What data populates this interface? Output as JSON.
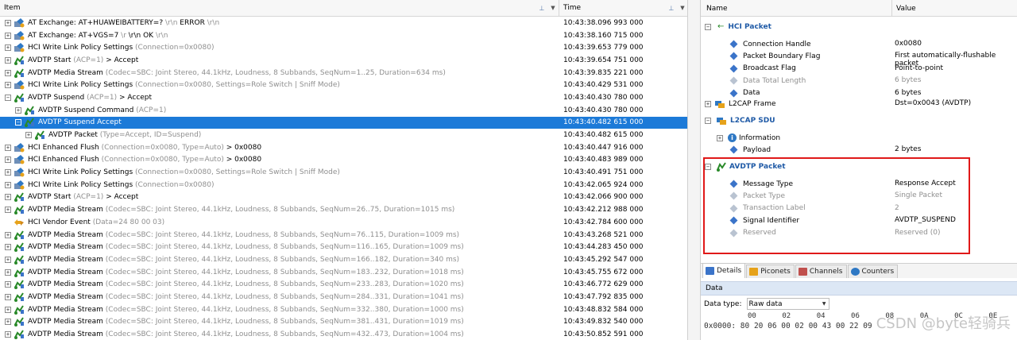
{
  "list": {
    "col_item": "Item",
    "col_time": "Time",
    "rows": [
      {
        "expander": "+",
        "icon": "hci-icon",
        "indent": 0,
        "name": "AT Exchange: AT+HUAWEIBATTERY=?",
        "params": " \\r\\n ",
        "suffix": "ERROR",
        "params2": " \\r\\n",
        "time": "10:43:38.096 993 000"
      },
      {
        "expander": "+",
        "icon": "hci-icon",
        "indent": 0,
        "name": "AT Exchange: AT+VGS=7",
        "params": " \\r ",
        "suffix": "\\r\\n OK",
        "params2": " \\r\\n",
        "time": "10:43:38.160 715 000"
      },
      {
        "expander": "+",
        "icon": "hci-icon",
        "indent": 0,
        "name": "HCI Write Link Policy Settings",
        "params": " (Connection=0x0080)",
        "suffix": "",
        "params2": "",
        "time": "10:43:39.653 779 000"
      },
      {
        "expander": "+",
        "icon": "avdtp-icon",
        "indent": 0,
        "name": "AVDTP Start",
        "params": " (ACP=1)",
        "suffix": " > Accept",
        "params2": "",
        "time": "10:43:39.654 751 000"
      },
      {
        "expander": "+",
        "icon": "avdtp-icon",
        "indent": 0,
        "name": "AVDTP Media Stream",
        "params": " (Codec=SBC: Joint Stereo, 44.1kHz, Loudness, 8 Subbands, SeqNum=1..25, Duration=634 ms)",
        "suffix": "",
        "params2": "",
        "time": "10:43:39.835 221 000"
      },
      {
        "expander": "+",
        "icon": "hci-icon",
        "indent": 0,
        "name": "HCI Write Link Policy Settings",
        "params": " (Connection=0x0080, Settings=Role Switch | Sniff Mode)",
        "suffix": "",
        "params2": "",
        "time": "10:43:40.429 531 000"
      },
      {
        "expander": "−",
        "icon": "avdtp-icon",
        "indent": 0,
        "name": "AVDTP Suspend",
        "params": " (ACP=1)",
        "suffix": " > Accept",
        "params2": "",
        "time": "10:43:40.430 780 000"
      },
      {
        "expander": "+",
        "icon": "avdtp-icon",
        "indent": 1,
        "name": "AVDTP Suspend Command",
        "params": " (ACP=1)",
        "suffix": "",
        "params2": "",
        "time": "10:43:40.430 780 000"
      },
      {
        "expander": "−",
        "icon": "avdtp-icon",
        "indent": 1,
        "name": "AVDTP Suspend Accept",
        "params": "",
        "suffix": "",
        "params2": "",
        "time": "10:43:40.482 615 000",
        "selected": true
      },
      {
        "expander": "+",
        "icon": "avdtp-icon",
        "indent": 2,
        "name": "AVDTP Packet",
        "params": " (Type=Accept, ID=Suspend)",
        "suffix": "",
        "params2": "",
        "time": "10:43:40.482 615 000"
      },
      {
        "expander": "+",
        "icon": "hci-icon",
        "indent": 0,
        "name": "HCI Enhanced Flush",
        "params": " (Connection=0x0080, Type=Auto)",
        "suffix": " > 0x0080",
        "params2": "",
        "time": "10:43:40.447 916 000"
      },
      {
        "expander": "+",
        "icon": "hci-icon",
        "indent": 0,
        "name": "HCI Enhanced Flush",
        "params": " (Connection=0x0080, Type=Auto)",
        "suffix": " > 0x0080",
        "params2": "",
        "time": "10:43:40.483 989 000"
      },
      {
        "expander": "+",
        "icon": "hci-icon",
        "indent": 0,
        "name": "HCI Write Link Policy Settings",
        "params": " (Connection=0x0080, Settings=Role Switch | Sniff Mode)",
        "suffix": "",
        "params2": "",
        "time": "10:43:40.491 751 000"
      },
      {
        "expander": "+",
        "icon": "hci-icon",
        "indent": 0,
        "name": "HCI Write Link Policy Settings",
        "params": " (Connection=0x0080)",
        "suffix": "",
        "params2": "",
        "time": "10:43:42.065 924 000"
      },
      {
        "expander": "+",
        "icon": "avdtp-icon",
        "indent": 0,
        "name": "AVDTP Start",
        "params": " (ACP=1)",
        "suffix": " > Accept",
        "params2": "",
        "time": "10:43:42.066 900 000"
      },
      {
        "expander": "+",
        "icon": "avdtp-icon",
        "indent": 0,
        "name": "AVDTP Media Stream",
        "params": " (Codec=SBC: Joint Stereo, 44.1kHz, Loudness, 8 Subbands, SeqNum=26..75, Duration=1015 ms)",
        "suffix": "",
        "params2": "",
        "time": "10:43:42.212 988 000"
      },
      {
        "expander": "",
        "icon": "vendor-icon",
        "indent": 0,
        "name": "HCI Vendor Event",
        "params": " (Data=24 80 00 03)",
        "suffix": "",
        "params2": "",
        "time": "10:43:42.784 600 000"
      },
      {
        "expander": "+",
        "icon": "avdtp-icon",
        "indent": 0,
        "name": "AVDTP Media Stream",
        "params": " (Codec=SBC: Joint Stereo, 44.1kHz, Loudness, 8 Subbands, SeqNum=76..115, Duration=1009 ms)",
        "suffix": "",
        "params2": "",
        "time": "10:43:43.268 521 000"
      },
      {
        "expander": "+",
        "icon": "avdtp-icon",
        "indent": 0,
        "name": "AVDTP Media Stream",
        "params": " (Codec=SBC: Joint Stereo, 44.1kHz, Loudness, 8 Subbands, SeqNum=116..165, Duration=1009 ms)",
        "suffix": "",
        "params2": "",
        "time": "10:43:44.283 450 000"
      },
      {
        "expander": "+",
        "icon": "avdtp-icon",
        "indent": 0,
        "name": "AVDTP Media Stream",
        "params": " (Codec=SBC: Joint Stereo, 44.1kHz, Loudness, 8 Subbands, SeqNum=166..182, Duration=340 ms)",
        "suffix": "",
        "params2": "",
        "time": "10:43:45.292 547 000"
      },
      {
        "expander": "+",
        "icon": "avdtp-icon",
        "indent": 0,
        "name": "AVDTP Media Stream",
        "params": " (Codec=SBC: Joint Stereo, 44.1kHz, Loudness, 8 Subbands, SeqNum=183..232, Duration=1018 ms)",
        "suffix": "",
        "params2": "",
        "time": "10:43:45.755 672 000"
      },
      {
        "expander": "+",
        "icon": "avdtp-icon",
        "indent": 0,
        "name": "AVDTP Media Stream",
        "params": " (Codec=SBC: Joint Stereo, 44.1kHz, Loudness, 8 Subbands, SeqNum=233..283, Duration=1020 ms)",
        "suffix": "",
        "params2": "",
        "time": "10:43:46.772 629 000"
      },
      {
        "expander": "+",
        "icon": "avdtp-icon",
        "indent": 0,
        "name": "AVDTP Media Stream",
        "params": " (Codec=SBC: Joint Stereo, 44.1kHz, Loudness, 8 Subbands, SeqNum=284..331, Duration=1041 ms)",
        "suffix": "",
        "params2": "",
        "time": "10:43:47.792 835 000"
      },
      {
        "expander": "+",
        "icon": "avdtp-icon",
        "indent": 0,
        "name": "AVDTP Media Stream",
        "params": " (Codec=SBC: Joint Stereo, 44.1kHz, Loudness, 8 Subbands, SeqNum=332..380, Duration=1000 ms)",
        "suffix": "",
        "params2": "",
        "time": "10:43:48.832 584 000"
      },
      {
        "expander": "+",
        "icon": "avdtp-icon",
        "indent": 0,
        "name": "AVDTP Media Stream",
        "params": " (Codec=SBC: Joint Stereo, 44.1kHz, Loudness, 8 Subbands, SeqNum=381..431, Duration=1019 ms)",
        "suffix": "",
        "params2": "",
        "time": "10:43:49.832 540 000"
      },
      {
        "expander": "+",
        "icon": "avdtp-icon",
        "indent": 0,
        "name": "AVDTP Media Stream",
        "params": " (Codec=SBC: Joint Stereo, 44.1kHz, Loudness, 8 Subbands, SeqNum=432..473, Duration=1004 ms)",
        "suffix": "",
        "params2": "",
        "time": "10:43:50.852 591 000"
      }
    ]
  },
  "details": {
    "col_name": "Name",
    "col_value": "Value",
    "hci_packet": "HCI Packet",
    "hci_fields": [
      {
        "name": "Connection Handle",
        "value": "0x0080",
        "gray": false
      },
      {
        "name": "Packet Boundary Flag",
        "value": "First automatically-flushable packet",
        "gray": false
      },
      {
        "name": "Broadcast Flag",
        "value": "Point-to-point",
        "gray": false
      },
      {
        "name": "Data Total Length",
        "value": "6 bytes",
        "gray": true
      },
      {
        "name": "Data",
        "value": "6 bytes",
        "gray": false
      }
    ],
    "l2cap_frame": "L2CAP Frame",
    "l2cap_frame_value": "Dst=0x0043 (AVDTP)",
    "l2cap_sdu": "L2CAP SDU",
    "information": "Information",
    "payload": "Payload",
    "payload_value": "2 bytes",
    "avdtp_packet": "AVDTP Packet",
    "avdtp_fields": [
      {
        "name": "Message Type",
        "value": "Response Accept",
        "gray": false
      },
      {
        "name": "Packet Type",
        "value": "Single Packet",
        "gray": true
      },
      {
        "name": "Transaction Label",
        "value": "2",
        "gray": true
      },
      {
        "name": "Signal Identifier",
        "value": "AVDTP_SUSPEND",
        "gray": false
      },
      {
        "name": "Reserved",
        "value": "Reserved (0)",
        "gray": true
      }
    ]
  },
  "tabs": [
    {
      "label": "Details",
      "icon": "details-icon",
      "active": true
    },
    {
      "label": "Piconets",
      "icon": "piconets-icon",
      "active": false
    },
    {
      "label": "Channels",
      "icon": "channels-icon",
      "active": false
    },
    {
      "label": "Counters",
      "icon": "counters-icon",
      "active": false
    }
  ],
  "data_panel": {
    "header": "Data",
    "type_label": "Data type:",
    "type_value": "Raw data",
    "offsets": "00      02      04      06      08      0A      0C      0E",
    "address": "0x0000:",
    "bytes": "80 20 06 00 02 00 43 00 22 09",
    "watermark": "CSDN @byte轻骑兵"
  },
  "colors": {
    "selection": "#1c7ad8",
    "group_title": "#1f5aa6",
    "highlight_box": "#e01919",
    "param_gray": "#8f8f8f"
  }
}
